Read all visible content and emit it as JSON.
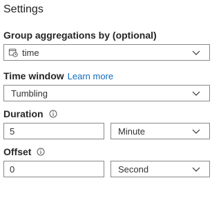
{
  "settings": {
    "title": "Settings",
    "group_aggregations": {
      "label": "Group aggregations by (optional)",
      "value": "time",
      "icon": "calendar-clock-icon"
    },
    "time_window": {
      "label": "Time window",
      "link_text": "Learn more",
      "value": "Tumbling"
    },
    "duration": {
      "label": "Duration",
      "value": "5",
      "unit": "Minute",
      "icon": "info-icon"
    },
    "offset": {
      "label": "Offset",
      "value": "0",
      "unit": "Second",
      "icon": "info-icon"
    }
  },
  "colors": {
    "link": "#0f6cbd",
    "border": "#8a8886",
    "text": "#323130"
  }
}
